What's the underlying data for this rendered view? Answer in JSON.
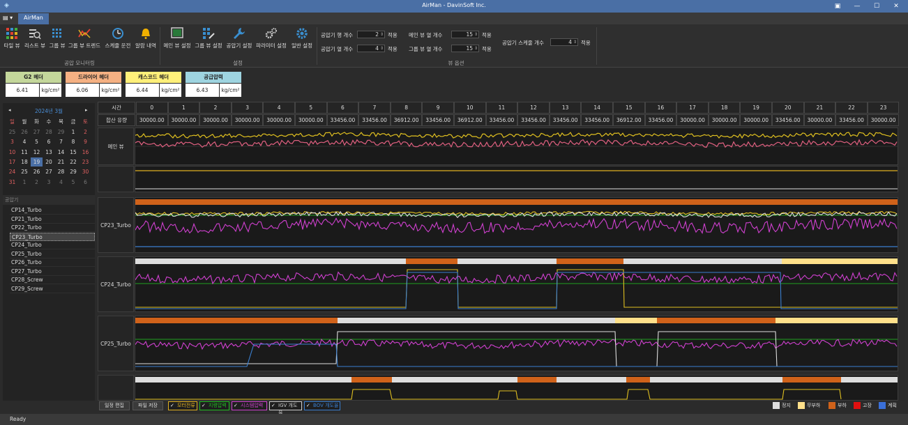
{
  "window": {
    "title": "AirMan - DavinSoft Inc."
  },
  "tabs": {
    "file": "▤ ▾",
    "active": "AirMan"
  },
  "ribbon": {
    "monitoring": {
      "group": "공압 모니터링",
      "buttons": [
        "타일 뷰",
        "리스트 뷰",
        "그룹 뷰",
        "그룹 뷰 트렌드",
        "스케쥴 운전",
        "알람 내역"
      ]
    },
    "settings": {
      "group": "설정",
      "buttons": [
        "메인 뷰 설정",
        "그룹 뷰 설정",
        "공압기 설정",
        "파라미터 설정",
        "일반 설정"
      ]
    },
    "view_options": {
      "group": "뷰 옵션",
      "row_count_label": "공압기 행 개수",
      "row_count": "2",
      "col_count_label": "공압기 열 개수",
      "col_count": "4",
      "main_col_label": "메인 뷰 열 개수",
      "main_col": "15",
      "group_col_label": "그룹 뷰 열 개수",
      "group_col": "15",
      "schedule_label": "공압기 스케줄 개수",
      "schedule": "4",
      "apply": "적용"
    }
  },
  "headers": [
    {
      "name": "G2 헤더",
      "value": "6.41",
      "unit": "kg/cm²",
      "color": "#c4d79b"
    },
    {
      "name": "드라이어 헤더",
      "value": "6.06",
      "unit": "kg/cm²",
      "color": "#f5b183"
    },
    {
      "name": "캐스코드 헤더",
      "value": "6.44",
      "unit": "kg/cm²",
      "color": "#fff07a"
    },
    {
      "name": "공급압력",
      "value": "6.43",
      "unit": "kg/cm²",
      "color": "#9ed4e0"
    }
  ],
  "calendar": {
    "title": "2024년 3월",
    "prev": "◂",
    "next": "▸",
    "weekdays": [
      "일",
      "월",
      "화",
      "수",
      "목",
      "금",
      "토"
    ],
    "weeks": [
      [
        "25",
        "26",
        "27",
        "28",
        "29",
        "1",
        "2"
      ],
      [
        "3",
        "4",
        "5",
        "6",
        "7",
        "8",
        "9"
      ],
      [
        "10",
        "11",
        "12",
        "13",
        "14",
        "15",
        "16"
      ],
      [
        "17",
        "18",
        "19",
        "20",
        "21",
        "22",
        "23"
      ],
      [
        "24",
        "25",
        "26",
        "27",
        "28",
        "29",
        "30"
      ],
      [
        "31",
        "1",
        "2",
        "3",
        "4",
        "5",
        "6"
      ]
    ],
    "selected": "19"
  },
  "compressors": {
    "title": "공압기",
    "items": [
      "CP14_Turbo",
      "CP21_Turbo",
      "CP22_Turbo",
      "CP23_Turbo",
      "CP24_Turbo",
      "CP25_Turbo",
      "CP26_Turbo",
      "CP27_Turbo",
      "CP28_Screw",
      "CP29_Screw"
    ],
    "selected": "CP23_Turbo"
  },
  "grid": {
    "time_label": "시간",
    "flow_label": "합산 유량",
    "hours": [
      "0",
      "1",
      "2",
      "3",
      "4",
      "5",
      "6",
      "7",
      "8",
      "9",
      "10",
      "11",
      "12",
      "13",
      "14",
      "15",
      "16",
      "17",
      "18",
      "19",
      "20",
      "21",
      "22",
      "23"
    ],
    "flows": [
      "30000.00",
      "30000.00",
      "30000.00",
      "30000.00",
      "30000.00",
      "30000.00",
      "33456.00",
      "33456.00",
      "36912.00",
      "33456.00",
      "36912.00",
      "33456.00",
      "33456.00",
      "33456.00",
      "33456.00",
      "36912.00",
      "33456.00",
      "30000.00",
      "30000.00",
      "30000.00",
      "33456.00",
      "30000.00",
      "33456.00",
      "30000.00"
    ]
  },
  "rows": {
    "main": "메인 뷰",
    "cp23": "CP23_Turbo",
    "cp24": "CP24_Turbo",
    "cp25": "CP25_Turbo"
  },
  "bottom": {
    "schedule_edit": "일정 편집",
    "save_file": "파일 저장",
    "checks": [
      {
        "label": "모터전류",
        "color": "#e0b020"
      },
      {
        "label": "지령압력",
        "color": "#20c020"
      },
      {
        "label": "시스템압력",
        "color": "#d040d0"
      },
      {
        "label": "IGV 개도율",
        "color": "#cccccc"
      },
      {
        "label": "BOV 개도율",
        "color": "#3a7fd0"
      }
    ],
    "legend": [
      {
        "label": "정지",
        "color": "#dddddd"
      },
      {
        "label": "무부하",
        "color": "#ffe08a"
      },
      {
        "label": "부하",
        "color": "#d0621a"
      },
      {
        "label": "고장",
        "color": "#e01010"
      },
      {
        "label": "계획",
        "color": "#3a6fd8"
      }
    ]
  },
  "status": "Ready"
}
